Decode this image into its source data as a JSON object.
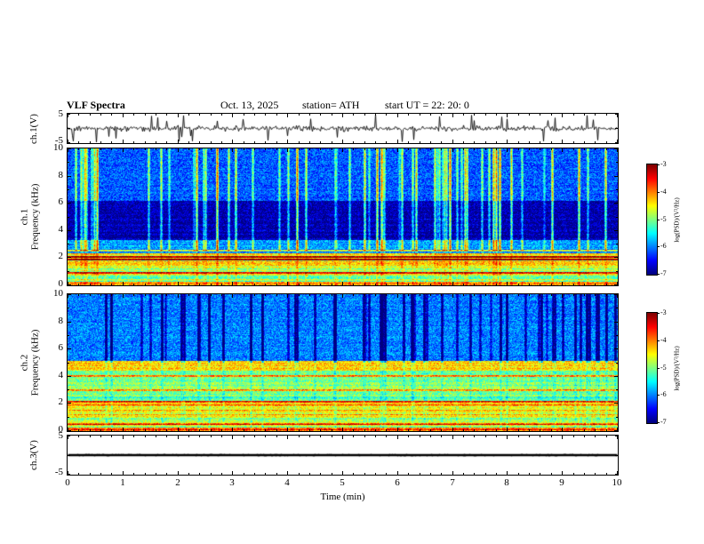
{
  "header": {
    "title": "VLF  Spectra",
    "date": "Oct. 13, 2025",
    "station": "station= ATH",
    "start_ut": "start UT  =   22: 20: 0"
  },
  "axes": {
    "time_label": "Time  (min)",
    "time_ticks": [
      "0",
      "1",
      "2",
      "3",
      "4",
      "5",
      "6",
      "7",
      "8",
      "9",
      "10"
    ],
    "freq_ticks": [
      "0",
      "2",
      "4",
      "6",
      "8",
      "10"
    ],
    "volt_ticks": [
      "5",
      "-5"
    ]
  },
  "panels": {
    "ch1_wave": {
      "label": "ch.1(V)"
    },
    "ch1_spec": {
      "label_line1": "ch.1",
      "label_line2": "Frequency  (kHz)"
    },
    "ch2_spec": {
      "label_line1": "ch.2",
      "label_line2": "Frequency  (kHz)"
    },
    "ch3_wave": {
      "label": "ch.3(V)"
    }
  },
  "colorbar": {
    "label": "log(PSD)/(V²/Hz)",
    "ticks": [
      "-3",
      "-4",
      "-5",
      "-6",
      "-7"
    ],
    "vmax": -3,
    "vmin": -7
  },
  "chart_data": [
    {
      "type": "line",
      "panel": "ch1_waveform",
      "title": "ch.1 time series",
      "ylabel": "ch.1(V)",
      "xlabel": "Time (min)",
      "xlim": [
        0,
        10
      ],
      "ylim": [
        -5,
        5
      ],
      "seed": 42,
      "noise_amplitude_v": 0.9,
      "spike_probability": 0.055,
      "spike_amplitude_v": [
        2.5,
        5
      ],
      "character": "continuous broadband noise of about ±1.5 V with frequent impulsive sferic spikes reaching ±5 V"
    },
    {
      "type": "heatmap",
      "panel": "ch1_spectrogram",
      "title": "ch.1 spectrogram",
      "ylabel": "ch.1 Frequency (kHz)",
      "xlabel": "Time (min)",
      "zlabel": "log(PSD)/(V²/Hz)",
      "xlim": [
        0,
        10
      ],
      "ylim": [
        0,
        10
      ],
      "zlim": [
        -7,
        -3
      ],
      "seed": 101,
      "bands": [
        {
          "f": [
            0,
            0.25
          ],
          "level": -3.9
        },
        {
          "f": [
            0.25,
            0.65
          ],
          "level": -5.0
        },
        {
          "f": [
            0.65,
            1.2
          ],
          "level": -4.8
        },
        {
          "f": [
            1.2,
            2.3
          ],
          "level": -4.5
        },
        {
          "f": [
            2.3,
            3.3
          ],
          "level": -5.9
        },
        {
          "f": [
            3.3,
            6.2
          ],
          "level": -6.85
        },
        {
          "f": [
            6.2,
            10
          ],
          "level": -6.15
        }
      ],
      "line_frequencies_khz": [
        0.9,
        1.85,
        2.05,
        2.5
      ],
      "line_boost": 1.2,
      "streaks": {
        "probability": 0.09,
        "strength": [
          0.7,
          2.4
        ],
        "region_khz": [
          2.5,
          10
        ],
        "sign": 1
      },
      "character": "quiet dark-blue band 3-6 kHz, medium blue above 6 kHz with green speckle, bright vertical broadband sferic streaks, yellow-green band 1.2-2.3 kHz, intense red-orange power below 0.25 kHz"
    },
    {
      "type": "heatmap",
      "panel": "ch2_spectrogram",
      "title": "ch.2 spectrogram",
      "ylabel": "ch.2 Frequency (kHz)",
      "xlabel": "Time (min)",
      "zlabel": "log(PSD)/(V²/Hz)",
      "xlim": [
        0,
        10
      ],
      "ylim": [
        0,
        10
      ],
      "zlim": [
        -7,
        -3
      ],
      "seed": 202,
      "bands": [
        {
          "f": [
            0,
            0.25
          ],
          "level": -3.8
        },
        {
          "f": [
            0.25,
            1.0
          ],
          "level": -4.7
        },
        {
          "f": [
            1.0,
            2.2
          ],
          "level": -4.45
        },
        {
          "f": [
            2.2,
            4.4
          ],
          "level": -5.0
        },
        {
          "f": [
            4.4,
            5.1
          ],
          "level": -4.35
        },
        {
          "f": [
            5.1,
            10
          ],
          "level": -6.0
        }
      ],
      "line_frequencies_khz": [
        0.5,
        1.9,
        2.1,
        3.0,
        4.0
      ],
      "line_boost": 1.0,
      "streaks": {
        "probability": 0.09,
        "strength": [
          0.6,
          1.8
        ],
        "region_khz": [
          5,
          10
        ],
        "sign": -1
      },
      "character": "green noisy floor below 5 kHz with orange-red harmonic lines near 2 kHz, bright green band 4.4-5.1 kHz, light blue above 5 kHz crossed by dark vertical sferic streaks, red-orange power below 0.25 kHz"
    },
    {
      "type": "line",
      "panel": "ch3_waveform",
      "title": "ch.3 time series",
      "ylabel": "ch.3(V)",
      "xlabel": "Time (min)",
      "xlim": [
        0,
        10
      ],
      "ylim": [
        -5,
        5
      ],
      "seed": 7,
      "noise_amplitude_v": 0.03,
      "spike_probability": 0,
      "spike_amplitude_v": [
        0,
        0
      ],
      "character": "flat trace pinned at 0 V (inactive channel)"
    }
  ]
}
